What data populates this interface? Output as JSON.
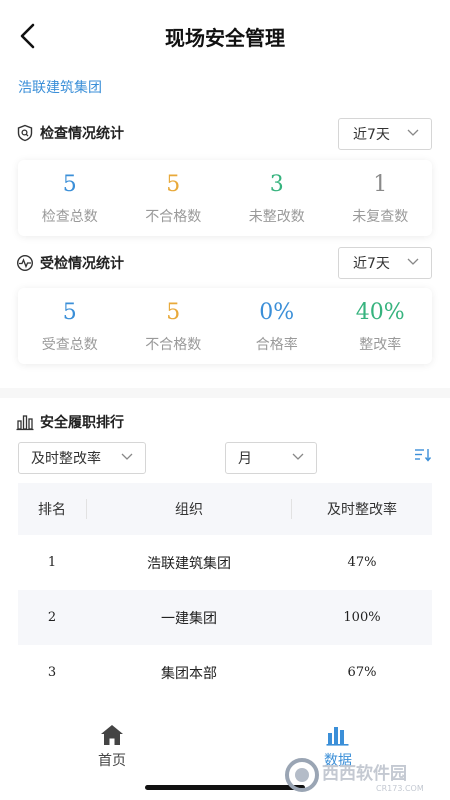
{
  "header": {
    "title": "现场安全管理"
  },
  "org": {
    "name": "浩联建筑集团"
  },
  "inspection": {
    "title": "检查情况统计",
    "range": "近7天",
    "stats": [
      {
        "value": "5",
        "label": "检查总数",
        "color": "#3b8fd8"
      },
      {
        "value": "5",
        "label": "不合格数",
        "color": "#e8a93a"
      },
      {
        "value": "3",
        "label": "未整改数",
        "color": "#36b37e"
      },
      {
        "value": "1",
        "label": "未复查数",
        "color": "#8a8a8a"
      }
    ]
  },
  "inspected": {
    "title": "受检情况统计",
    "range": "近7天",
    "stats": [
      {
        "value": "5",
        "label": "受查总数",
        "color": "#3b8fd8"
      },
      {
        "value": "5",
        "label": "不合格数",
        "color": "#e8a93a"
      },
      {
        "value": "0%",
        "label": "合格率",
        "color": "#3b8fd8"
      },
      {
        "value": "40%",
        "label": "整改率",
        "color": "#36b37e"
      }
    ]
  },
  "ranking": {
    "title": "安全履职排行",
    "metric_filter": "及时整改率",
    "period_filter": "月",
    "columns": [
      "排名",
      "组织",
      "及时整改率"
    ],
    "rows": [
      {
        "rank": "1",
        "org": "浩联建筑集团",
        "rate": "47%"
      },
      {
        "rank": "2",
        "org": "一建集团",
        "rate": "100%"
      },
      {
        "rank": "3",
        "org": "集团本部",
        "rate": "67%"
      }
    ]
  },
  "tabs": [
    {
      "label": "首页",
      "icon": "home-icon",
      "active": false
    },
    {
      "label": "数据",
      "icon": "bar-chart-icon",
      "active": true
    }
  ],
  "colors": {
    "accent": "#3b8fd8",
    "inactive_tab": "#444444"
  },
  "watermark": {
    "text": "西西软件园",
    "subtext": "CR173.COM"
  }
}
